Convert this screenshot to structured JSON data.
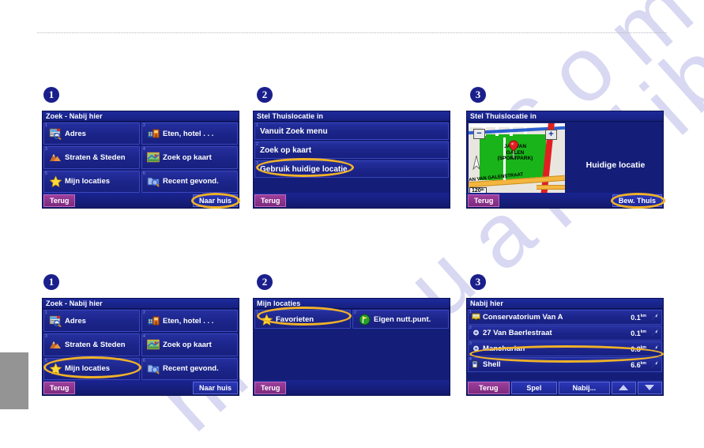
{
  "page": {
    "background": "#ffffff",
    "accent_highlight": "#f0b228",
    "screen_bg": "#141e78",
    "button_purple": "#8d318d",
    "button_blue": "#2b37b8"
  },
  "watermark": {
    "words": [
      "m",
      "a",
      "n",
      "u",
      "a",
      "l",
      "s",
      "l",
      "i",
      "b",
      ".",
      "c",
      "o",
      "m"
    ],
    "color": "#d8d8f2"
  },
  "steps": {
    "one": "1",
    "two": "2",
    "three": "3"
  },
  "panels": {
    "top1": {
      "title": "Zoek - Nabij hier",
      "items": [
        {
          "num": "1",
          "label": "Adres",
          "icon": "address-card-icon"
        },
        {
          "num": "2",
          "label": "Eten, hotel . . .",
          "icon": "food-hotel-icon"
        },
        {
          "num": "3",
          "label": "Straten & Steden",
          "icon": "mountains-icon"
        },
        {
          "num": "4",
          "label": "Zoek op kaart",
          "icon": "map-search-icon"
        },
        {
          "num": "5",
          "label": "Mijn locaties",
          "icon": "star-icon"
        },
        {
          "num": "6",
          "label": "Recent gevond.",
          "icon": "recent-folder-icon"
        }
      ],
      "back_label": "Terug",
      "home_label": "Naar huis",
      "highlighted": "Naar huis"
    },
    "top2": {
      "title": "Stel Thuislocatie in",
      "items": [
        {
          "num": "1",
          "label": "Vanuit Zoek menu"
        },
        {
          "num": "2",
          "label": "Zoek op kaart"
        },
        {
          "num": "3",
          "label": "Gebruik huidige locatie"
        }
      ],
      "back_label": "Terug",
      "highlighted": "Gebruik huidige locatie"
    },
    "top3": {
      "title": "Stel Thuislocatie in",
      "map": {
        "place_label_line1": "JAN VAN",
        "place_label_line2": "GALEN",
        "place_label_line3": "(SPORTPARK)",
        "street_label": "JAN VAN GALENSTRAAT",
        "scale": "120ᵐ",
        "zoom_in": "+",
        "zoom_out": "−"
      },
      "side_text": "Huidige locatie",
      "back_label": "Terug",
      "save_label": "Bew. Thuis",
      "highlighted": "Bew. Thuis"
    },
    "bot1": {
      "title": "Zoek - Nabij hier",
      "items": [
        {
          "num": "1",
          "label": "Adres",
          "icon": "address-card-icon"
        },
        {
          "num": "2",
          "label": "Eten, hotel . . .",
          "icon": "food-hotel-icon"
        },
        {
          "num": "3",
          "label": "Straten & Steden",
          "icon": "mountains-icon"
        },
        {
          "num": "4",
          "label": "Zoek op kaart",
          "icon": "map-search-icon"
        },
        {
          "num": "5",
          "label": "Mijn locaties",
          "icon": "star-icon"
        },
        {
          "num": "6",
          "label": "Recent gevond.",
          "icon": "recent-folder-icon"
        }
      ],
      "back_label": "Terug",
      "home_label": "Naar huis",
      "highlighted": "Mijn locaties"
    },
    "bot2": {
      "title": "Mijn locaties",
      "items": [
        {
          "num": "1",
          "label": "Favorieten",
          "icon": "star-icon"
        },
        {
          "num": "2",
          "label": "Eigen nutt.punt.",
          "icon": "green-flag-icon"
        }
      ],
      "back_label": "Terug",
      "highlighted": "Favorieten"
    },
    "bot3": {
      "title": "Nabij hier",
      "pois": [
        {
          "num": "1",
          "name": "Conservatorium Van A",
          "dist": "0.1",
          "unit": "km",
          "icon": "bus-icon"
        },
        {
          "num": "2",
          "name": "27 Van Baerlestraat",
          "dist": "0.1",
          "unit": "km",
          "icon": "dot-icon"
        },
        {
          "num": "3",
          "name": "Manchurian",
          "dist": "0.8",
          "unit": "km",
          "icon": "dot-icon"
        },
        {
          "num": "4",
          "name": "Shell",
          "dist": "6.6",
          "unit": "km",
          "icon": "fuel-icon"
        }
      ],
      "buttons": {
        "back": "Terug",
        "spell": "Spel",
        "near": "Nabij...",
        "scroll_up": "scroll-up",
        "scroll_down": "scroll-down"
      },
      "highlighted": "Manchurian"
    }
  }
}
